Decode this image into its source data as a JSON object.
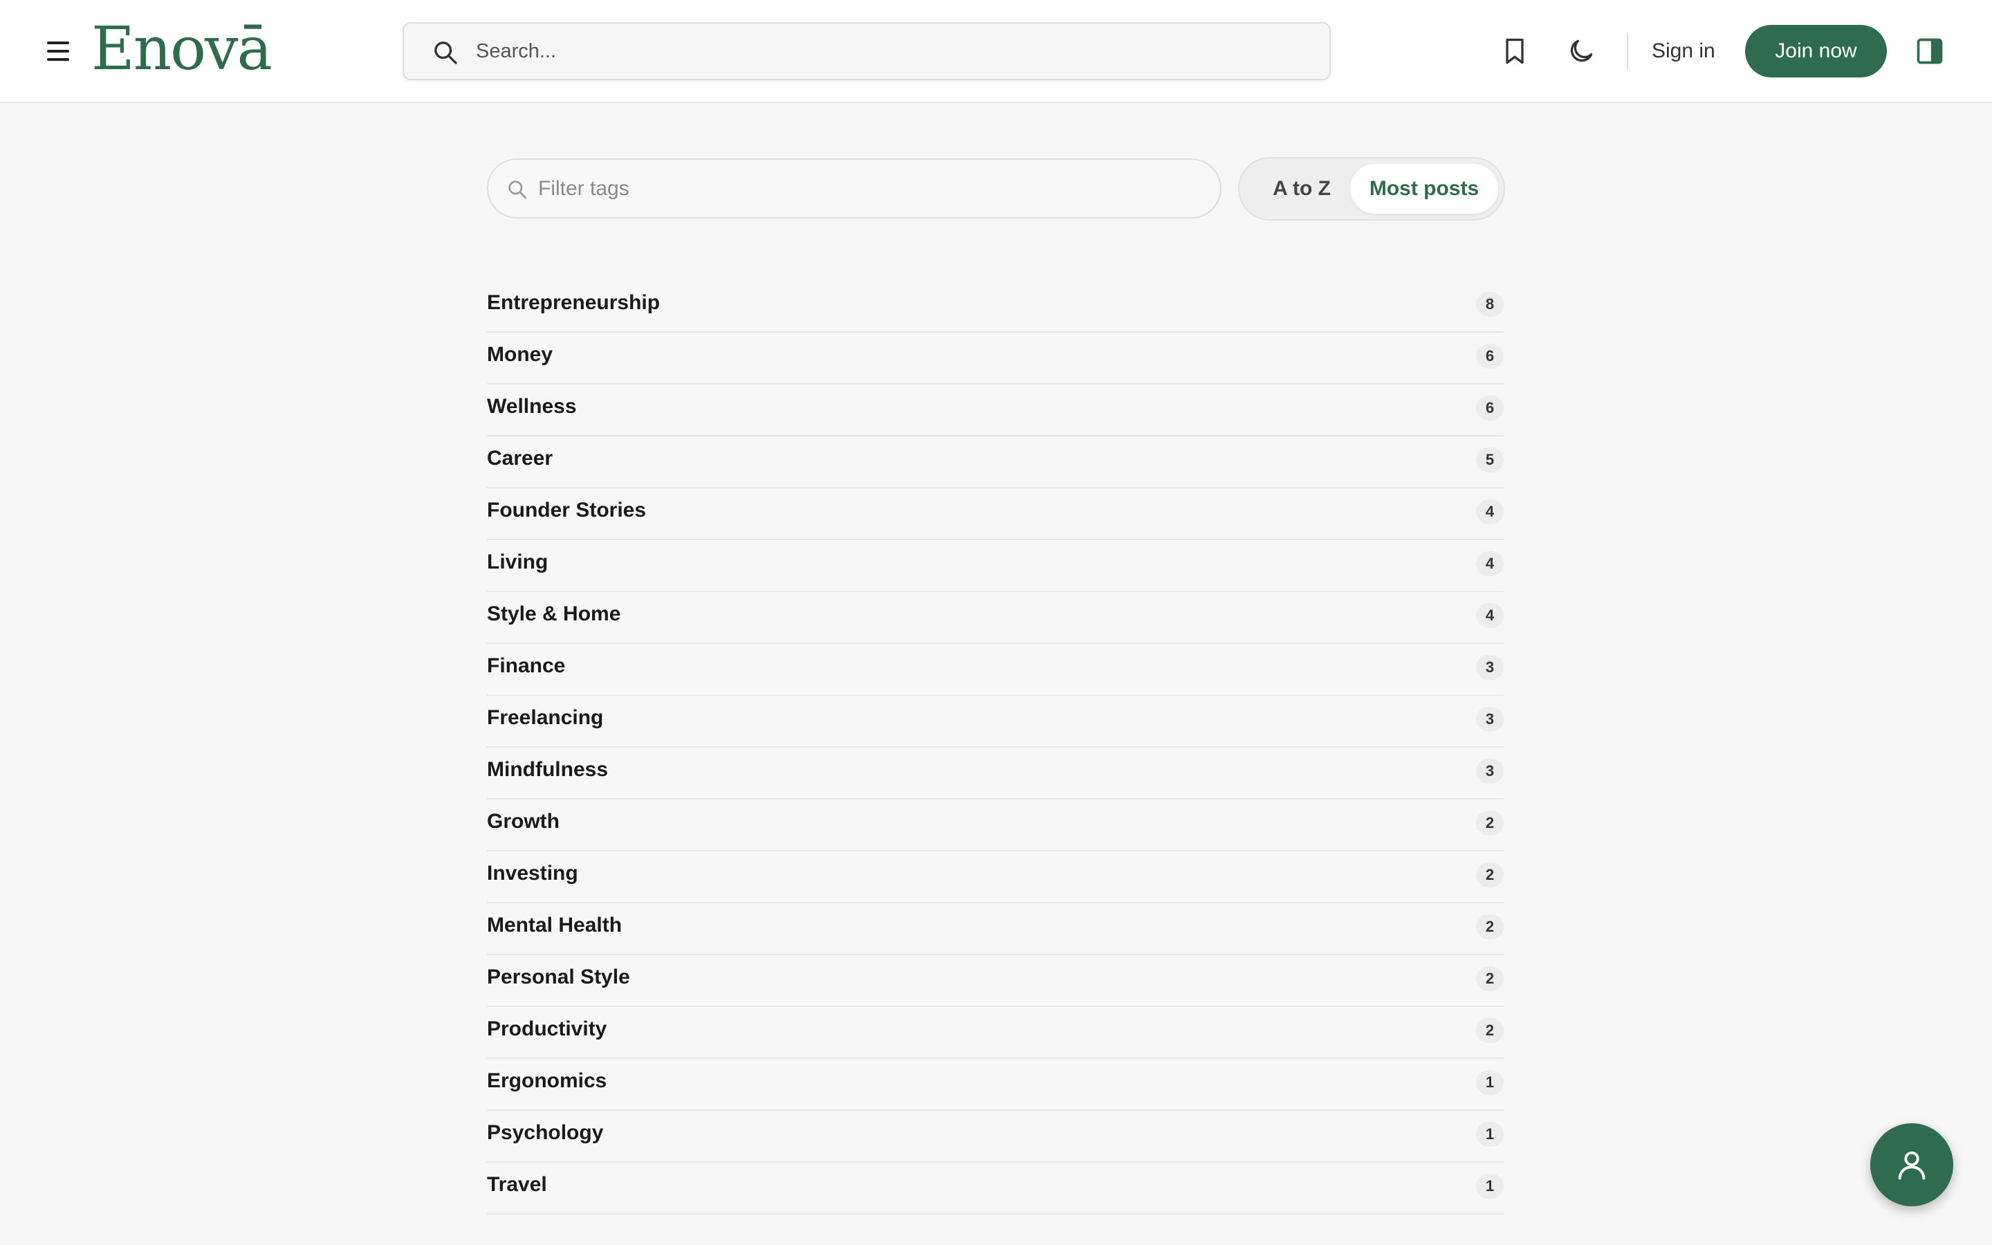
{
  "header": {
    "logo_text": "Enovā",
    "search_placeholder": "Search...",
    "sign_in_label": "Sign in",
    "join_label": "Join now",
    "icons": [
      "menu-icon",
      "search-icon",
      "bookmark-icon",
      "moon-icon",
      "sidebar-panel-icon"
    ]
  },
  "filter": {
    "placeholder": "Filter tags",
    "sort_options": [
      "A to Z",
      "Most posts"
    ],
    "selected_sort": "Most posts"
  },
  "tags": [
    {
      "name": "Entrepreneurship",
      "count": "8"
    },
    {
      "name": "Money",
      "count": "6"
    },
    {
      "name": "Wellness",
      "count": "6"
    },
    {
      "name": "Career",
      "count": "5"
    },
    {
      "name": "Founder Stories",
      "count": "4"
    },
    {
      "name": "Living",
      "count": "4"
    },
    {
      "name": "Style & Home",
      "count": "4"
    },
    {
      "name": "Finance",
      "count": "3"
    },
    {
      "name": "Freelancing",
      "count": "3"
    },
    {
      "name": "Mindfulness",
      "count": "3"
    },
    {
      "name": "Growth",
      "count": "2"
    },
    {
      "name": "Investing",
      "count": "2"
    },
    {
      "name": "Mental Health",
      "count": "2"
    },
    {
      "name": "Personal Style",
      "count": "2"
    },
    {
      "name": "Productivity",
      "count": "2"
    },
    {
      "name": "Ergonomics",
      "count": "1"
    },
    {
      "name": "Psychology",
      "count": "1"
    },
    {
      "name": "Travel",
      "count": "1"
    }
  ],
  "colors": {
    "brand": "#2f6b4f",
    "background": "#f7f7f7",
    "header_bg": "#ffffff"
  }
}
